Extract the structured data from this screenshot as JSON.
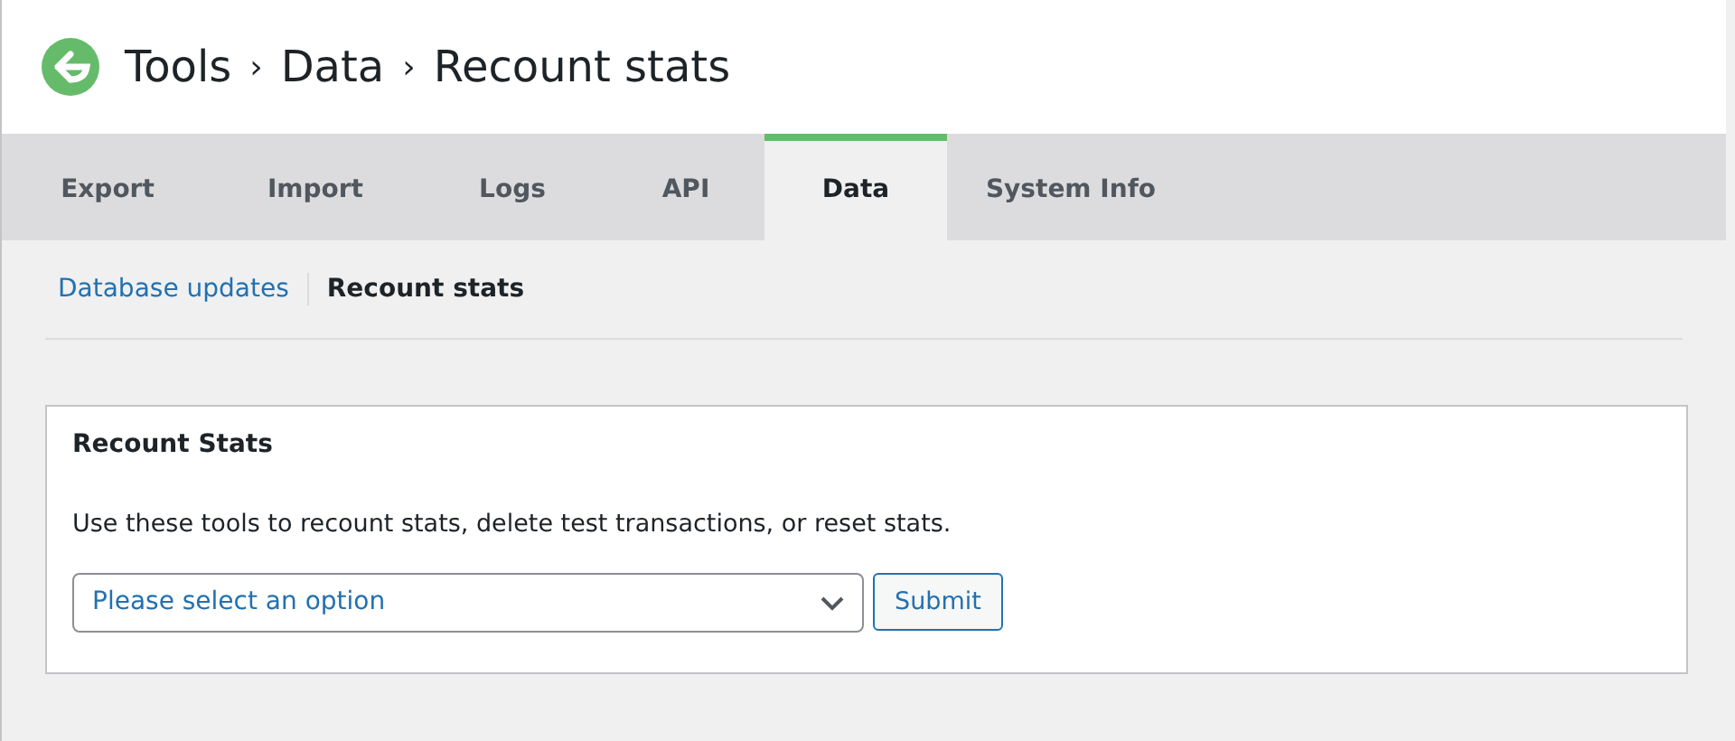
{
  "header": {
    "breadcrumb": [
      "Tools",
      "Data",
      "Recount stats"
    ],
    "separators": [
      "›",
      "›"
    ]
  },
  "tabs": [
    {
      "label": "Export",
      "selected": false
    },
    {
      "label": "Import",
      "selected": false
    },
    {
      "label": "Logs",
      "selected": false
    },
    {
      "label": "API",
      "selected": false
    },
    {
      "label": "Data",
      "selected": true
    },
    {
      "label": "System Info",
      "selected": false
    }
  ],
  "subnav": [
    {
      "label": "Database updates",
      "selected": false
    },
    {
      "label": "Recount stats",
      "selected": true
    }
  ],
  "panel": {
    "title": "Recount Stats",
    "description": "Use these tools to recount stats, delete test transactions, or reset stats.",
    "select": {
      "placeholder": "Please select an option"
    },
    "button": "Submit"
  }
}
